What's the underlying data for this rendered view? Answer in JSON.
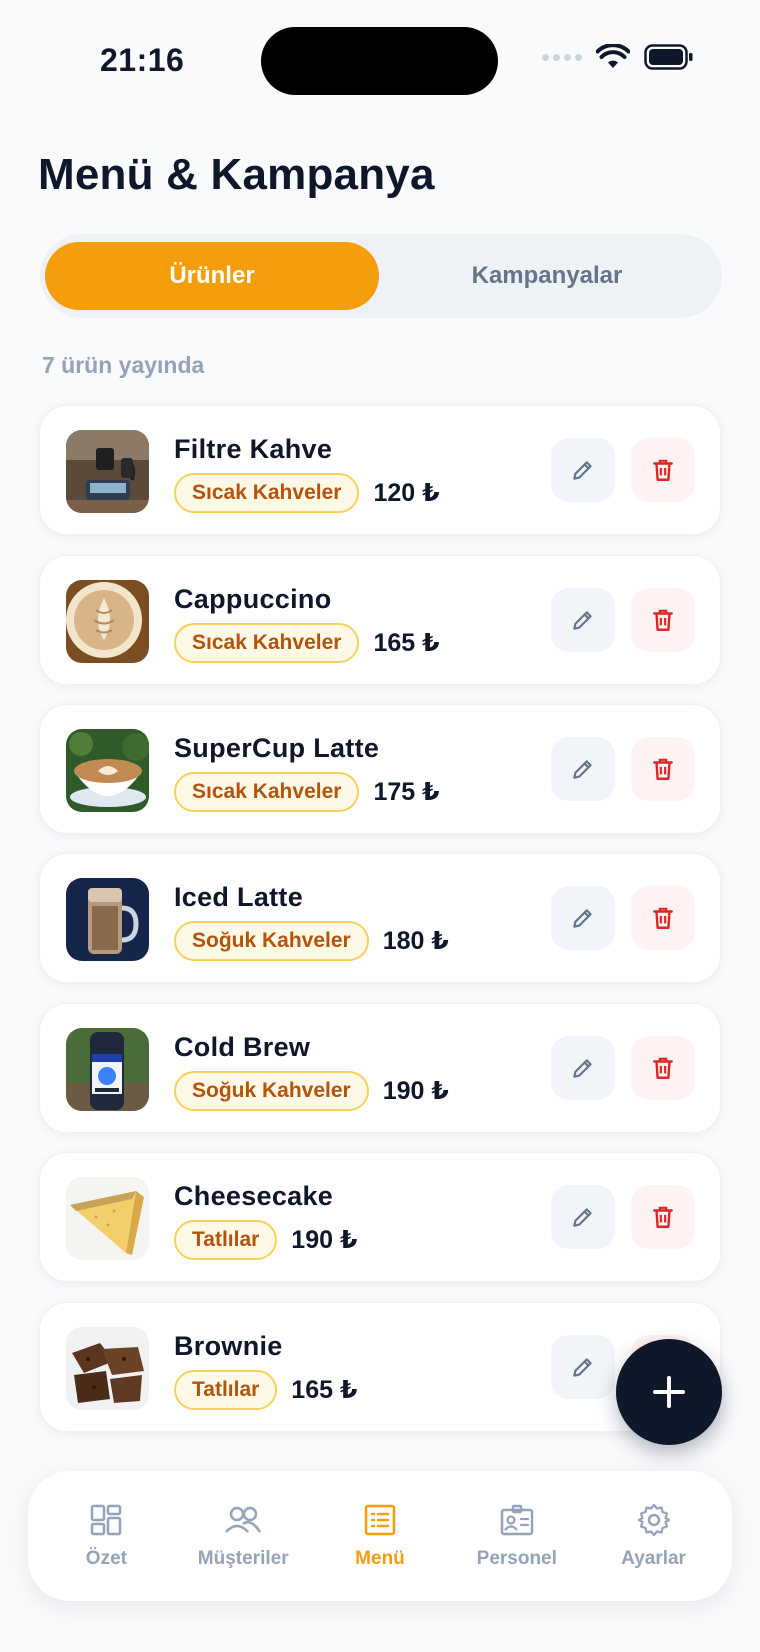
{
  "status_bar": {
    "time": "21:16"
  },
  "header": {
    "title": "Menü & Kampanya"
  },
  "segments": {
    "active": "Ürünler",
    "inactive": "Kampanyalar"
  },
  "summary": {
    "count_text": "7 ürün yayında"
  },
  "products": [
    {
      "name": "Filtre Kahve",
      "category": "Sıcak Kahveler",
      "price": "120 ₺",
      "image": "filter-coffee-photo"
    },
    {
      "name": "Cappuccino",
      "category": "Sıcak Kahveler",
      "price": "165 ₺",
      "image": "cappuccino-photo"
    },
    {
      "name": "SuperCup Latte",
      "category": "Sıcak Kahveler",
      "price": "175 ₺",
      "image": "latte-photo"
    },
    {
      "name": "Iced Latte",
      "category": "Soğuk Kahveler",
      "price": "180 ₺",
      "image": "iced-latte-photo"
    },
    {
      "name": "Cold Brew",
      "category": "Soğuk Kahveler",
      "price": "190 ₺",
      "image": "cold-brew-photo"
    },
    {
      "name": "Cheesecake",
      "category": "Tatlılar",
      "price": "190 ₺",
      "image": "cheesecake-photo"
    },
    {
      "name": "Brownie",
      "category": "Tatlılar",
      "price": "165 ₺",
      "image": "brownie-photo"
    }
  ],
  "tabbar": {
    "items": [
      {
        "label": "Özet",
        "icon": "dashboard-icon"
      },
      {
        "label": "Müşteriler",
        "icon": "users-icon"
      },
      {
        "label": "Menü",
        "icon": "menu-list-icon",
        "active": true
      },
      {
        "label": "Personel",
        "icon": "id-badge-icon"
      },
      {
        "label": "Ayarlar",
        "icon": "gear-icon"
      }
    ]
  },
  "colors": {
    "accent": "#f59e0b",
    "dark": "#0f172a",
    "danger": "#dc2626",
    "muted": "#94a3b8"
  }
}
